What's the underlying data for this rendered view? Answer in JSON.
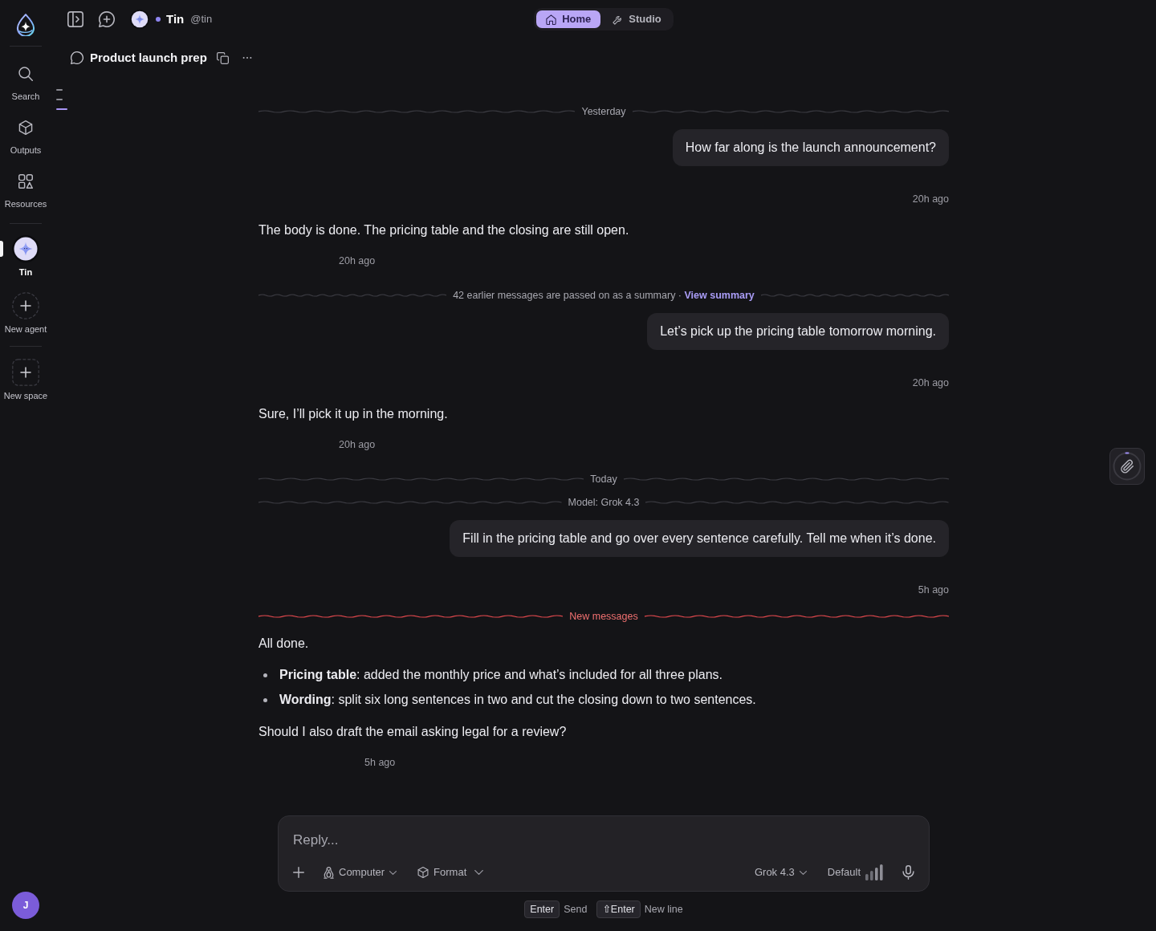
{
  "rail": {
    "items": [
      {
        "kind": "search",
        "label": "Search"
      },
      {
        "kind": "outputs",
        "label": "Outputs"
      },
      {
        "kind": "resources",
        "label": "Resources"
      }
    ],
    "agents": [
      {
        "name": "Tin",
        "selected": true
      }
    ],
    "actions": [
      {
        "kind": "new_agent",
        "label": "New agent"
      },
      {
        "kind": "new_space",
        "label": "New space"
      }
    ],
    "user": {
      "initial": "J"
    }
  },
  "header": {
    "agent": {
      "name": "Tin",
      "handle": "@tin",
      "online": true
    },
    "modes": [
      {
        "kind": "home",
        "label": "Home",
        "selected": true
      },
      {
        "kind": "studio",
        "label": "Studio",
        "selected": false
      }
    ]
  },
  "conversation": {
    "title": "Product launch prep"
  },
  "timeline": [
    {
      "selected": false
    },
    {
      "selected": false
    },
    {
      "selected": true
    }
  ],
  "thread": [
    {
      "kind": "divider",
      "highlighted": false,
      "text": "Yesterday"
    },
    {
      "kind": "user",
      "text": "How far along is the launch announcement?",
      "time": "20h ago"
    },
    {
      "kind": "assistant",
      "blocks": [
        {
          "kind": "paragraph",
          "text": "The body is done. The pricing table and the closing are still open."
        }
      ],
      "time": "20h ago"
    },
    {
      "kind": "summary",
      "text": "42 earlier messages are passed on as a summary ·",
      "link": "View summary"
    },
    {
      "kind": "user",
      "text": "Let’s pick up the pricing table tomorrow morning.",
      "time": "20h ago"
    },
    {
      "kind": "assistant",
      "blocks": [
        {
          "kind": "paragraph",
          "text": "Sure, I’ll pick it up in the morning."
        }
      ],
      "time": "20h ago"
    },
    {
      "kind": "divider",
      "highlighted": false,
      "text": "Today"
    },
    {
      "kind": "divider",
      "highlighted": false,
      "text": "Model: Grok 4.3"
    },
    {
      "kind": "user",
      "text": "Fill in the pricing table and go over every sentence carefully. Tell me when it’s done.",
      "time": "5h ago"
    },
    {
      "kind": "divider",
      "highlighted": true,
      "text": "New messages"
    },
    {
      "kind": "assistant",
      "blocks": [
        {
          "kind": "paragraph",
          "text": "All done."
        },
        {
          "kind": "list",
          "items": [
            "**Pricing table**: added the monthly price and what’s included for all three plans.",
            "**Wording**: split six long sentences in two and cut the closing down to two sentences."
          ]
        },
        {
          "kind": "paragraph",
          "text": "Should I also draft the email asking legal for a review?"
        }
      ],
      "time": "5h ago"
    }
  ],
  "composer": {
    "placeholder": "Reply...",
    "menus": [
      {
        "kind": "computer",
        "label": "Computer"
      },
      {
        "kind": "format",
        "label": "Format"
      }
    ],
    "model": "Grok 4.3",
    "effort": "Default"
  },
  "hints": [
    {
      "key": "Enter",
      "label": "Send"
    },
    {
      "key": "⇧Enter",
      "label": "New line"
    }
  ]
}
